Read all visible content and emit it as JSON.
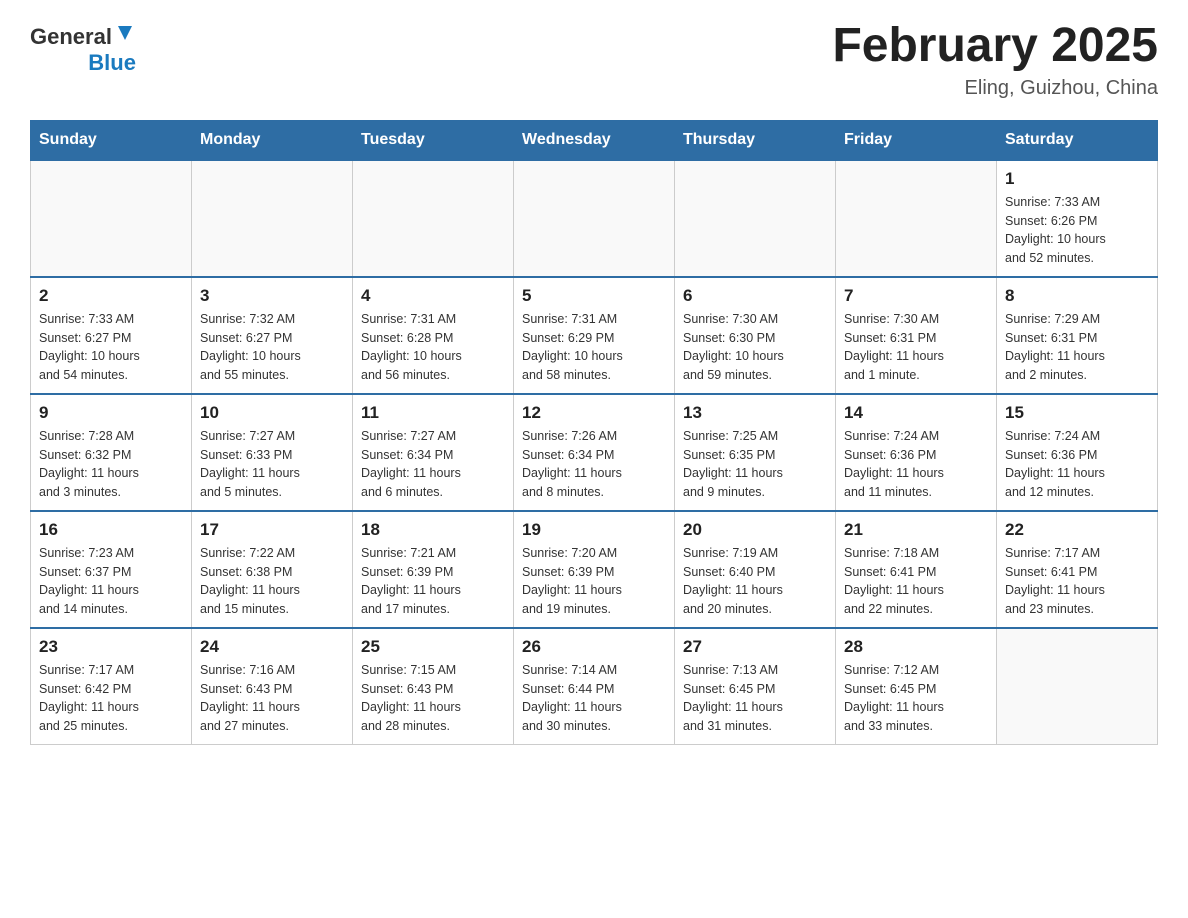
{
  "header": {
    "logo_general": "General",
    "logo_blue": "Blue",
    "month_title": "February 2025",
    "location": "Eling, Guizhou, China"
  },
  "days_of_week": [
    "Sunday",
    "Monday",
    "Tuesday",
    "Wednesday",
    "Thursday",
    "Friday",
    "Saturday"
  ],
  "weeks": [
    {
      "days": [
        {
          "date": "",
          "info": ""
        },
        {
          "date": "",
          "info": ""
        },
        {
          "date": "",
          "info": ""
        },
        {
          "date": "",
          "info": ""
        },
        {
          "date": "",
          "info": ""
        },
        {
          "date": "",
          "info": ""
        },
        {
          "date": "1",
          "info": "Sunrise: 7:33 AM\nSunset: 6:26 PM\nDaylight: 10 hours\nand 52 minutes."
        }
      ]
    },
    {
      "days": [
        {
          "date": "2",
          "info": "Sunrise: 7:33 AM\nSunset: 6:27 PM\nDaylight: 10 hours\nand 54 minutes."
        },
        {
          "date": "3",
          "info": "Sunrise: 7:32 AM\nSunset: 6:27 PM\nDaylight: 10 hours\nand 55 minutes."
        },
        {
          "date": "4",
          "info": "Sunrise: 7:31 AM\nSunset: 6:28 PM\nDaylight: 10 hours\nand 56 minutes."
        },
        {
          "date": "5",
          "info": "Sunrise: 7:31 AM\nSunset: 6:29 PM\nDaylight: 10 hours\nand 58 minutes."
        },
        {
          "date": "6",
          "info": "Sunrise: 7:30 AM\nSunset: 6:30 PM\nDaylight: 10 hours\nand 59 minutes."
        },
        {
          "date": "7",
          "info": "Sunrise: 7:30 AM\nSunset: 6:31 PM\nDaylight: 11 hours\nand 1 minute."
        },
        {
          "date": "8",
          "info": "Sunrise: 7:29 AM\nSunset: 6:31 PM\nDaylight: 11 hours\nand 2 minutes."
        }
      ]
    },
    {
      "days": [
        {
          "date": "9",
          "info": "Sunrise: 7:28 AM\nSunset: 6:32 PM\nDaylight: 11 hours\nand 3 minutes."
        },
        {
          "date": "10",
          "info": "Sunrise: 7:27 AM\nSunset: 6:33 PM\nDaylight: 11 hours\nand 5 minutes."
        },
        {
          "date": "11",
          "info": "Sunrise: 7:27 AM\nSunset: 6:34 PM\nDaylight: 11 hours\nand 6 minutes."
        },
        {
          "date": "12",
          "info": "Sunrise: 7:26 AM\nSunset: 6:34 PM\nDaylight: 11 hours\nand 8 minutes."
        },
        {
          "date": "13",
          "info": "Sunrise: 7:25 AM\nSunset: 6:35 PM\nDaylight: 11 hours\nand 9 minutes."
        },
        {
          "date": "14",
          "info": "Sunrise: 7:24 AM\nSunset: 6:36 PM\nDaylight: 11 hours\nand 11 minutes."
        },
        {
          "date": "15",
          "info": "Sunrise: 7:24 AM\nSunset: 6:36 PM\nDaylight: 11 hours\nand 12 minutes."
        }
      ]
    },
    {
      "days": [
        {
          "date": "16",
          "info": "Sunrise: 7:23 AM\nSunset: 6:37 PM\nDaylight: 11 hours\nand 14 minutes."
        },
        {
          "date": "17",
          "info": "Sunrise: 7:22 AM\nSunset: 6:38 PM\nDaylight: 11 hours\nand 15 minutes."
        },
        {
          "date": "18",
          "info": "Sunrise: 7:21 AM\nSunset: 6:39 PM\nDaylight: 11 hours\nand 17 minutes."
        },
        {
          "date": "19",
          "info": "Sunrise: 7:20 AM\nSunset: 6:39 PM\nDaylight: 11 hours\nand 19 minutes."
        },
        {
          "date": "20",
          "info": "Sunrise: 7:19 AM\nSunset: 6:40 PM\nDaylight: 11 hours\nand 20 minutes."
        },
        {
          "date": "21",
          "info": "Sunrise: 7:18 AM\nSunset: 6:41 PM\nDaylight: 11 hours\nand 22 minutes."
        },
        {
          "date": "22",
          "info": "Sunrise: 7:17 AM\nSunset: 6:41 PM\nDaylight: 11 hours\nand 23 minutes."
        }
      ]
    },
    {
      "days": [
        {
          "date": "23",
          "info": "Sunrise: 7:17 AM\nSunset: 6:42 PM\nDaylight: 11 hours\nand 25 minutes."
        },
        {
          "date": "24",
          "info": "Sunrise: 7:16 AM\nSunset: 6:43 PM\nDaylight: 11 hours\nand 27 minutes."
        },
        {
          "date": "25",
          "info": "Sunrise: 7:15 AM\nSunset: 6:43 PM\nDaylight: 11 hours\nand 28 minutes."
        },
        {
          "date": "26",
          "info": "Sunrise: 7:14 AM\nSunset: 6:44 PM\nDaylight: 11 hours\nand 30 minutes."
        },
        {
          "date": "27",
          "info": "Sunrise: 7:13 AM\nSunset: 6:45 PM\nDaylight: 11 hours\nand 31 minutes."
        },
        {
          "date": "28",
          "info": "Sunrise: 7:12 AM\nSunset: 6:45 PM\nDaylight: 11 hours\nand 33 minutes."
        },
        {
          "date": "",
          "info": ""
        }
      ]
    }
  ]
}
